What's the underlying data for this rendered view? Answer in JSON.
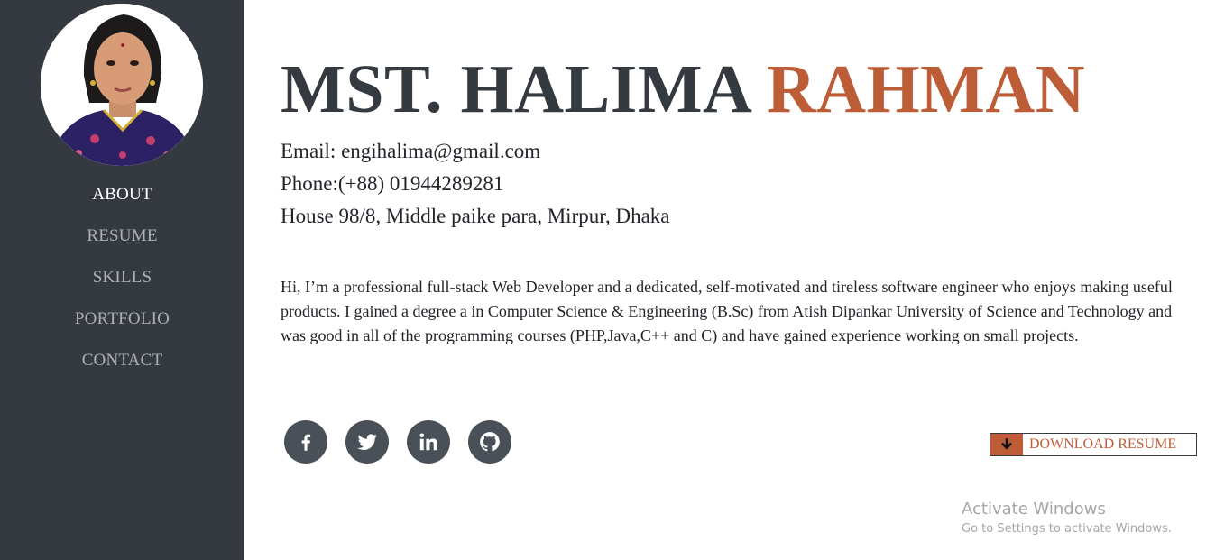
{
  "sidebar": {
    "avatar_alt": "profile photo",
    "nav": [
      {
        "label": "ABOUT",
        "active": true
      },
      {
        "label": "RESUME",
        "active": false
      },
      {
        "label": "SKILLS",
        "active": false
      },
      {
        "label": "PORTFOLIO",
        "active": false
      },
      {
        "label": "CONTACT",
        "active": false
      }
    ]
  },
  "header": {
    "first_name": "MST. HALIMA",
    "last_name": "RAHMAN"
  },
  "contact": {
    "email": "Email: engihalima@gmail.com",
    "phone": "Phone:(+88) 01944289281",
    "address": "House 98/8, Middle paike para, Mirpur, Dhaka"
  },
  "bio": "Hi, I’m a professional full-stack Web Developer and a dedicated, self-motivated and tireless software engineer who enjoys making useful products. I gained a degree a in Computer Science & Engineering (B.Sc) from Atish Dipankar University of Science and Technology and was good in all of the programming courses (PHP,Java,C++ and C) and have gained experience working on small projects.",
  "social": [
    {
      "icon": "facebook-icon"
    },
    {
      "icon": "twitter-icon"
    },
    {
      "icon": "linkedin-icon"
    },
    {
      "icon": "github-icon"
    }
  ],
  "download": {
    "label": "DOWNLOAD RESUME",
    "icon": "arrow-down-icon"
  },
  "watermark": {
    "title": "Activate Windows",
    "subtitle": "Go to Settings to activate Windows."
  },
  "colors": {
    "sidebar": "#343a40",
    "accent": "#bd5d38",
    "icon_bg": "#495057"
  }
}
